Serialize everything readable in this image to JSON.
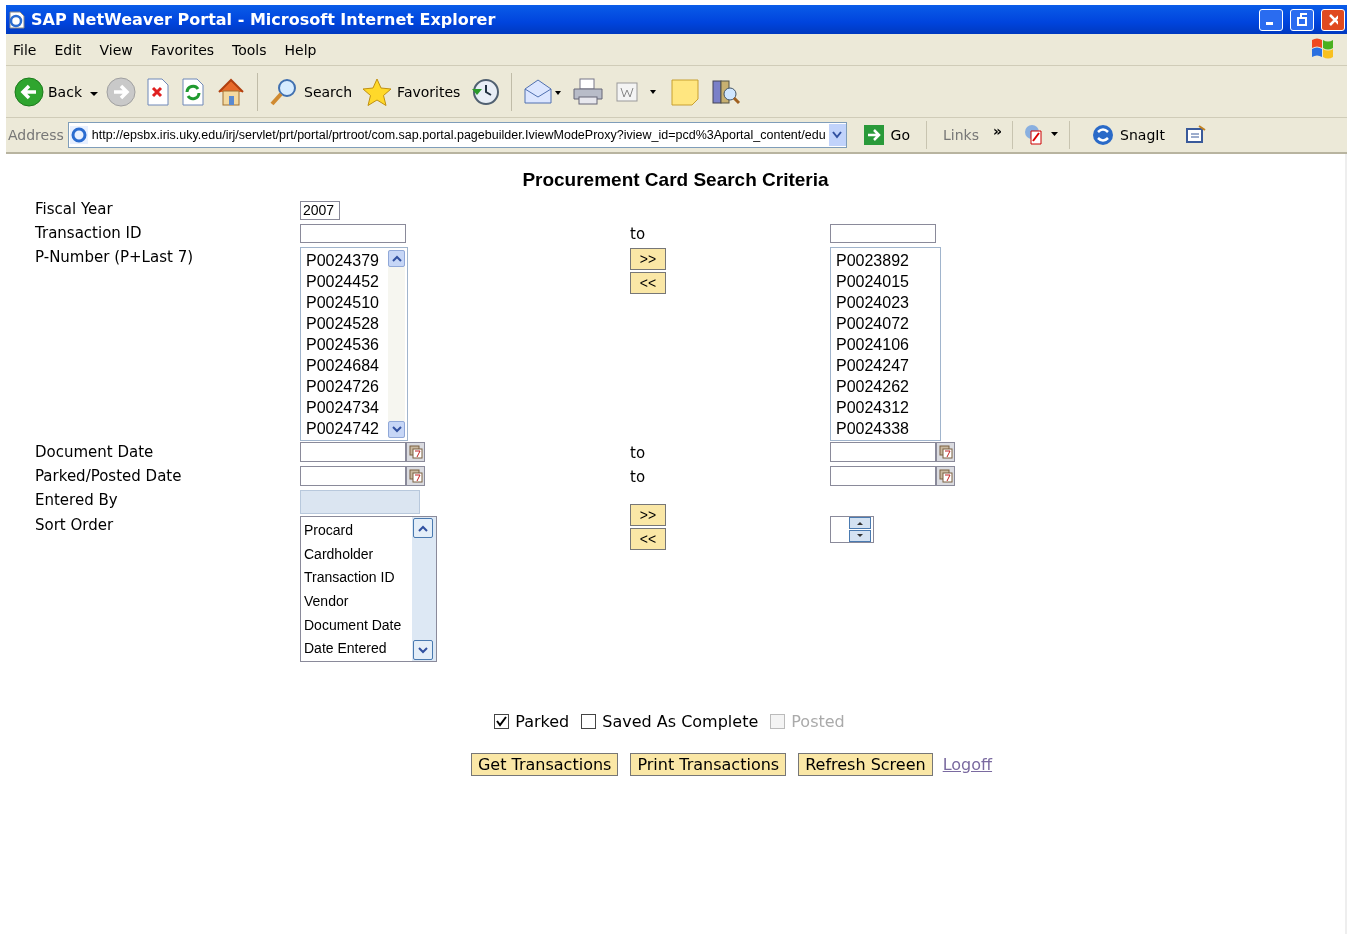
{
  "window": {
    "title": "SAP NetWeaver Portal - Microsoft Internet Explorer"
  },
  "menu": [
    "File",
    "Edit",
    "View",
    "Favorites",
    "Tools",
    "Help"
  ],
  "toolbar": [
    {
      "kind": "back",
      "label": "Back"
    },
    {
      "kind": "forward"
    },
    {
      "kind": "stop"
    },
    {
      "kind": "refresh"
    },
    {
      "kind": "home"
    },
    {
      "kind": "search",
      "label": "Search"
    },
    {
      "kind": "favorites",
      "label": "Favorites"
    },
    {
      "kind": "history"
    },
    {
      "kind": "mail"
    },
    {
      "kind": "print"
    },
    {
      "kind": "edit"
    },
    {
      "kind": "note"
    },
    {
      "kind": "research"
    }
  ],
  "address": {
    "label": "Address",
    "url": "http://epsbx.iris.uky.edu/irj/servlet/prt/portal/prtroot/com.sap.portal.pagebuilder.IviewModeProxy?iview_id=pcd%3Aportal_content/edu",
    "go": "Go",
    "links": "Links",
    "chevron": "»",
    "snagit": "SnagIt"
  },
  "form": {
    "title": "Procurement Card Search Criteria",
    "fiscal_year": {
      "label": "Fiscal Year",
      "value": "2007"
    },
    "transaction_id": {
      "label": "Transaction ID",
      "to": "to"
    },
    "p_number": {
      "label": "P-Number (P+Last 7)",
      "add": ">>",
      "remove": "<<",
      "available": [
        "P0024379",
        "P0024452",
        "P0024510",
        "P0024528",
        "P0024536",
        "P0024684",
        "P0024726",
        "P0024734",
        "P0024742"
      ],
      "chosen": [
        "P0023892",
        "P0024015",
        "P0024023",
        "P0024072",
        "P0024106",
        "P0024247",
        "P0024262",
        "P0024312",
        "P0024338"
      ]
    },
    "document_date": {
      "label": "Document Date",
      "to": "to"
    },
    "parked_posted_date": {
      "label": "Parked/Posted Date",
      "to": "to"
    },
    "entered_by": {
      "label": "Entered By",
      "disabled": true
    },
    "sort_order": {
      "label": "Sort Order",
      "add": ">>",
      "remove": "<<",
      "options": [
        "Procard",
        "Cardholder",
        "Transaction ID",
        "Vendor",
        "Document Date",
        "Date Entered"
      ]
    },
    "statuses": [
      {
        "label": "Parked",
        "checked": true,
        "disabled": false
      },
      {
        "label": "Saved As Complete",
        "checked": false,
        "disabled": false
      },
      {
        "label": "Posted",
        "checked": false,
        "disabled": true
      }
    ],
    "buttons": [
      "Get Transactions",
      "Print Transactions",
      "Refresh Screen"
    ],
    "logoff": "Logoff"
  }
}
